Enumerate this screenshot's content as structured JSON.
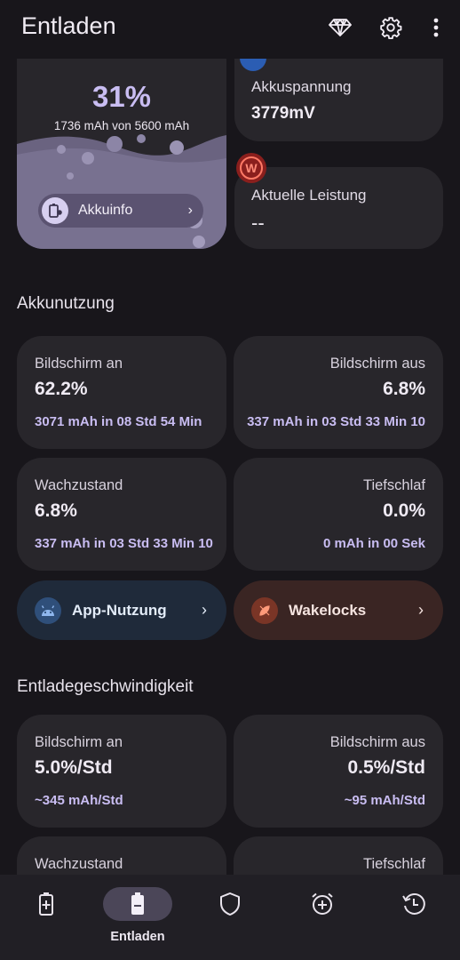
{
  "header": {
    "title": "Entladen"
  },
  "battery": {
    "percent": "31%",
    "capacity": "1736 mAh von 5600 mAh",
    "info_button": "Akkuinfo"
  },
  "voltage": {
    "label": "Akkuspannung",
    "value": "3779mV"
  },
  "power": {
    "label": "Aktuelle Leistung",
    "value": "--",
    "badge": "W"
  },
  "usage": {
    "title": "Akkunutzung",
    "screen_on": {
      "label": "Bildschirm an",
      "value": "62.2%",
      "detail": "3071 mAh in 08 Std 54 Min"
    },
    "screen_off": {
      "label": "Bildschirm aus",
      "value": "6.8%",
      "detail": "337 mAh in 03 Std 33 Min 10"
    },
    "awake": {
      "label": "Wachzustand",
      "value": "6.8%",
      "detail": "337 mAh in 03 Std 33 Min 10"
    },
    "deep_sleep": {
      "label": "Tiefschlaf",
      "value": "0.0%",
      "detail": "0 mAh in 00 Sek"
    },
    "app_usage": "App-Nutzung",
    "wakelocks": "Wakelocks"
  },
  "discharge": {
    "title": "Entladegeschwindigkeit",
    "screen_on": {
      "label": "Bildschirm an",
      "value": "5.0%/Std",
      "detail": "~345 mAh/Std"
    },
    "screen_off": {
      "label": "Bildschirm aus",
      "value": "0.5%/Std",
      "detail": "~95 mAh/Std"
    },
    "awake": {
      "label": "Wachzustand"
    },
    "deep_sleep": {
      "label": "Tiefschlaf"
    }
  },
  "nav": {
    "active_label": "Entladen"
  },
  "colors": {
    "accent": "#c9bdf2",
    "background": "#18161b",
    "card": "#28262b"
  }
}
